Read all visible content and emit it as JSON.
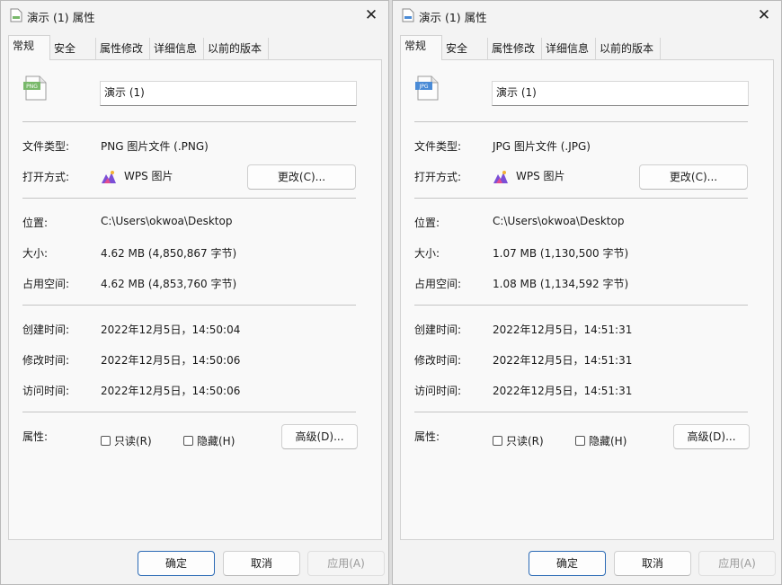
{
  "dialogs": [
    {
      "title": "演示 (1) 属性",
      "tabs": [
        "常规",
        "安全",
        "属性修改",
        "详细信息",
        "以前的版本"
      ],
      "file_icon_label": "PNG",
      "file_icon_color": "#78b86a",
      "file_name": "演示 (1)",
      "file_type_label": "文件类型:",
      "file_type_value": "PNG 图片文件 (.PNG)",
      "open_with_label": "打开方式:",
      "open_with_app": "WPS 图片",
      "change_button": "更改(C)...",
      "location_label": "位置:",
      "location_value": "C:\\Users\\okwoa\\Desktop",
      "size_label": "大小:",
      "size_value": "4.62 MB (4,850,867 字节)",
      "disk_size_label": "占用空间:",
      "disk_size_value": "4.62 MB (4,853,760 字节)",
      "created_label": "创建时间:",
      "created_value": "2022年12月5日，14:50:04",
      "modified_label": "修改时间:",
      "modified_value": "2022年12月5日，14:50:06",
      "accessed_label": "访问时间:",
      "accessed_value": "2022年12月5日，14:50:06",
      "attributes_label": "属性:",
      "readonly_label": "只读(R)",
      "hidden_label": "隐藏(H)",
      "advanced_button": "高级(D)...",
      "ok_button": "确定",
      "cancel_button": "取消",
      "apply_button": "应用(A)"
    },
    {
      "title": "演示 (1) 属性",
      "tabs": [
        "常规",
        "安全",
        "属性修改",
        "详细信息",
        "以前的版本"
      ],
      "file_icon_label": "JPG",
      "file_icon_color": "#4a8bd6",
      "file_name": "演示 (1)",
      "file_type_label": "文件类型:",
      "file_type_value": "JPG 图片文件 (.JPG)",
      "open_with_label": "打开方式:",
      "open_with_app": "WPS 图片",
      "change_button": "更改(C)...",
      "location_label": "位置:",
      "location_value": "C:\\Users\\okwoa\\Desktop",
      "size_label": "大小:",
      "size_value": "1.07 MB (1,130,500 字节)",
      "disk_size_label": "占用空间:",
      "disk_size_value": "1.08 MB (1,134,592 字节)",
      "created_label": "创建时间:",
      "created_value": "2022年12月5日，14:51:31",
      "modified_label": "修改时间:",
      "modified_value": "2022年12月5日，14:51:31",
      "accessed_label": "访问时间:",
      "accessed_value": "2022年12月5日，14:51:31",
      "attributes_label": "属性:",
      "readonly_label": "只读(R)",
      "hidden_label": "隐藏(H)",
      "advanced_button": "高级(D)...",
      "ok_button": "确定",
      "cancel_button": "取消",
      "apply_button": "应用(A)"
    }
  ]
}
